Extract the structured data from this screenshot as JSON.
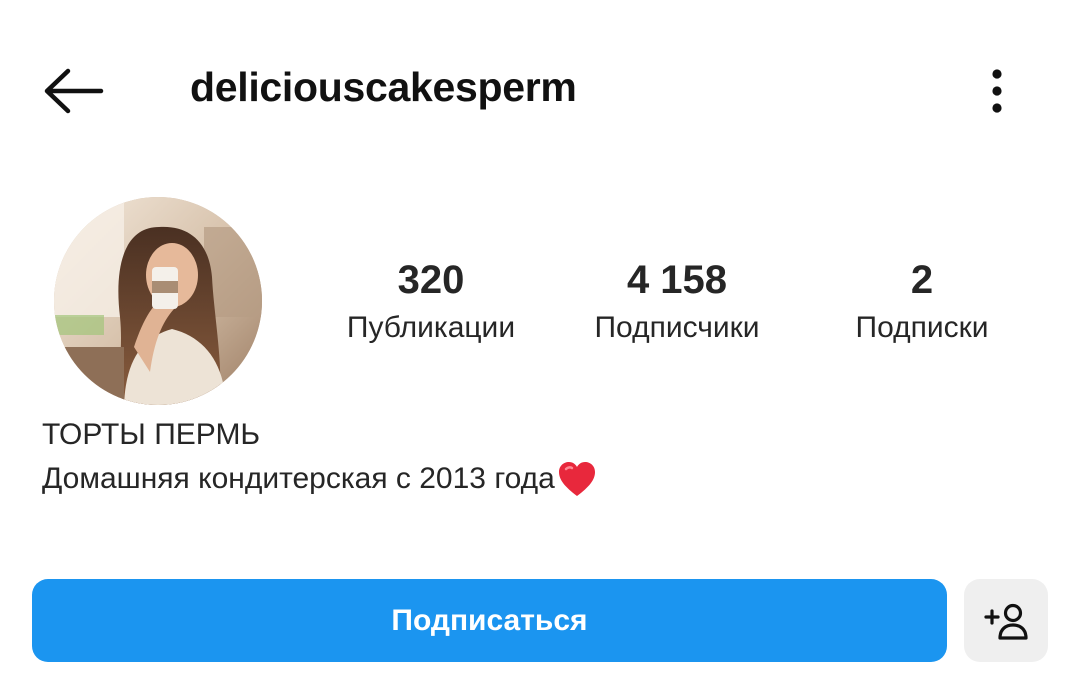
{
  "header": {
    "username": "deliciouscakesperm",
    "back_icon": "arrow-left-icon",
    "more_icon": "more-vertical-icon"
  },
  "profile": {
    "avatar_icon": "profile-photo",
    "stats": {
      "posts": {
        "value": "320",
        "label": "Публикации"
      },
      "followers": {
        "value": "4 158",
        "label": "Подписчики"
      },
      "following": {
        "value": "2",
        "label": "Подписки"
      }
    },
    "display_name": "ТОРТЫ ПЕРМЬ",
    "bio": "Домашняя кондитерская с 2013 года",
    "bio_emoji": "heart-icon"
  },
  "actions": {
    "follow_label": "Подписаться",
    "suggest_icon": "add-person-icon"
  },
  "colors": {
    "accent": "#1b95f0",
    "secondary_button": "#efefef",
    "text": "#262626",
    "heart": "#e8283c"
  }
}
